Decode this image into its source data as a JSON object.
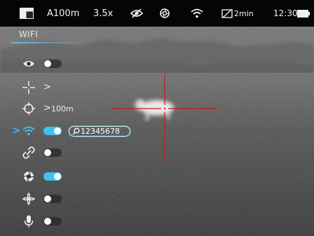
{
  "status_bar": {
    "mode_icon": "palette-icon",
    "profile": "A100m",
    "zoom": "3.5x",
    "icons": [
      "eye-off-icon",
      "aperture-icon",
      "wifi-icon"
    ],
    "auto_off_icon": "auto-off-icon",
    "auto_off": "2min",
    "time": "12:30",
    "battery_icon": "battery-icon"
  },
  "menu": {
    "title": "WIFI",
    "rows": [
      {
        "icon": "eye-icon",
        "control": "toggle",
        "state": "off"
      },
      {
        "icon": "crosshair-icon",
        "control": "chevron"
      },
      {
        "icon": "target-icon",
        "control": "chevron",
        "value": "100m"
      },
      {
        "icon": "wifi-icon",
        "control": "toggle",
        "state": "on",
        "selected": true,
        "password": "12345678",
        "password_icon": "key-icon"
      },
      {
        "icon": "link-icon",
        "control": "toggle",
        "state": "off"
      },
      {
        "icon": "aperture-icon",
        "control": "toggle",
        "state": "on"
      },
      {
        "icon": "compass-icon",
        "control": "toggle",
        "state": "off"
      },
      {
        "icon": "microphone-icon",
        "control": "toggle",
        "state": "off"
      }
    ],
    "chevron": ">",
    "selected_marker": ">"
  },
  "colors": {
    "accent": "#3fc1ee",
    "reticle": "#d01818",
    "status_bg": "#050505"
  }
}
